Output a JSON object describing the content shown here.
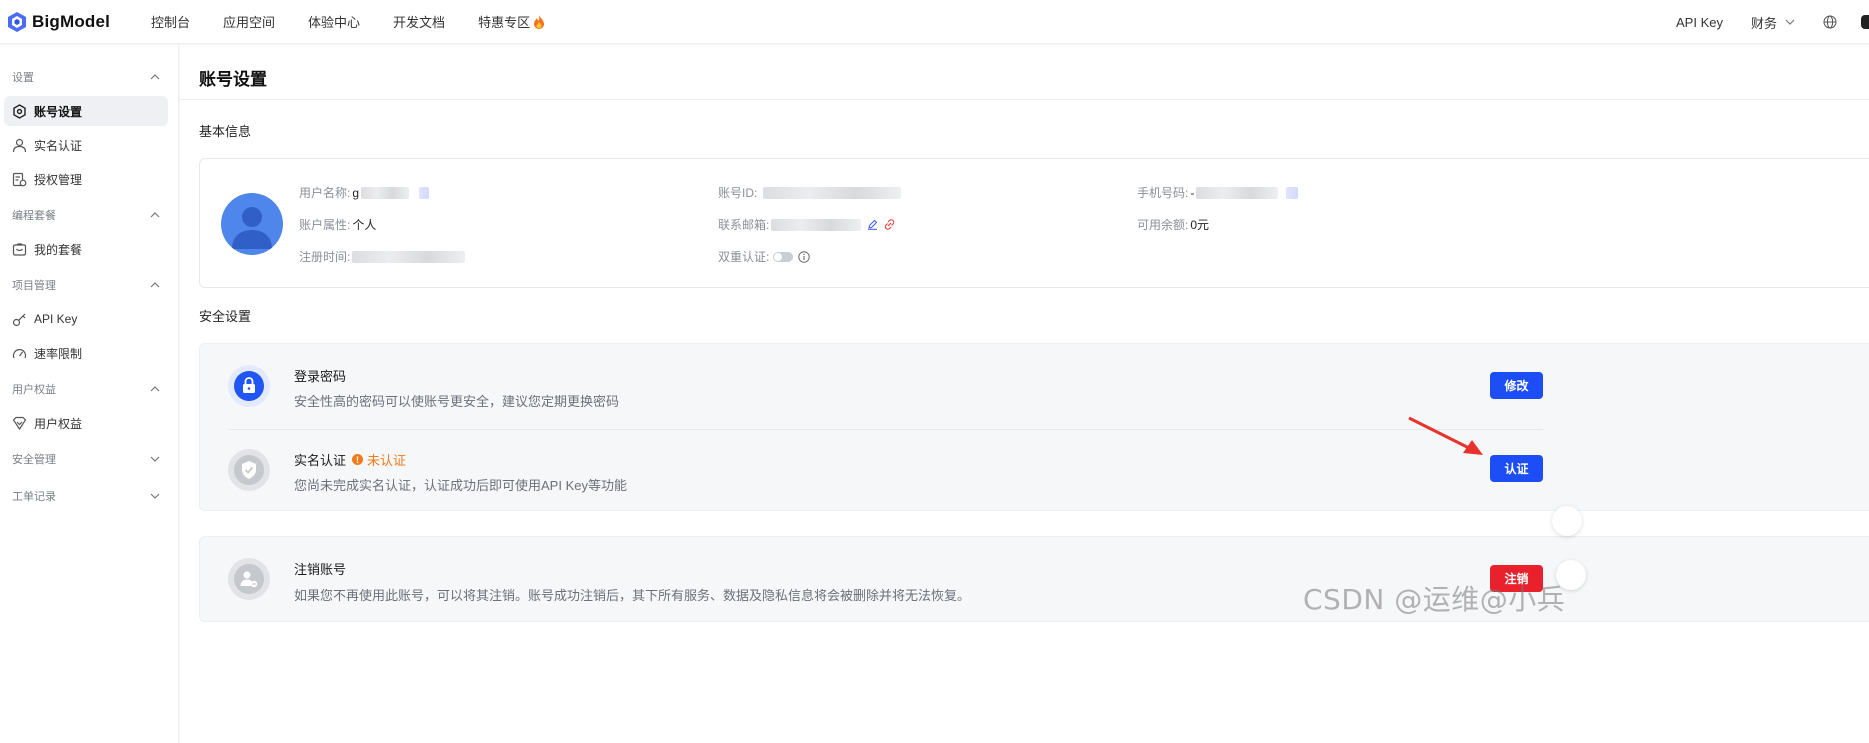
{
  "brand": {
    "name": "BigModel",
    "color": "#4a6cf7"
  },
  "topnav": {
    "items": [
      {
        "label": "控制台"
      },
      {
        "label": "应用空间"
      },
      {
        "label": "体验中心"
      },
      {
        "label": "开发文档"
      },
      {
        "label": "特惠专区",
        "icon": "fire-icon"
      }
    ],
    "right": {
      "api_key": "API Key",
      "finance": "财务",
      "icons": [
        "chevron-down-icon",
        "globe-icon"
      ]
    }
  },
  "sidebar": {
    "groups": [
      {
        "label": "设置",
        "expanded": true,
        "items": [
          {
            "label": "账号设置",
            "icon": "settings-icon",
            "active": true
          },
          {
            "label": "实名认证",
            "icon": "user-icon"
          },
          {
            "label": "授权管理",
            "icon": "authorize-icon"
          }
        ]
      },
      {
        "label": "编程套餐",
        "expanded": true,
        "items": [
          {
            "label": "我的套餐",
            "icon": "package-icon"
          }
        ]
      },
      {
        "label": "项目管理",
        "expanded": true,
        "items": [
          {
            "label": "API Key",
            "icon": "key-icon"
          },
          {
            "label": "速率限制",
            "icon": "gauge-icon"
          }
        ]
      },
      {
        "label": "用户权益",
        "expanded": true,
        "items": [
          {
            "label": "用户权益",
            "icon": "benefit-icon"
          }
        ]
      },
      {
        "label": "安全管理",
        "expanded": false,
        "items": []
      },
      {
        "label": "工单记录",
        "expanded": false,
        "items": []
      }
    ]
  },
  "main": {
    "title": "账号设置",
    "basic": {
      "title": "基本信息",
      "fields": {
        "username": {
          "label": "用户名称:",
          "value": "g"
        },
        "account_type": {
          "label": "账户属性:",
          "value": "个人"
        },
        "register_time": {
          "label": "注册时间:"
        },
        "account_id": {
          "label": "账号ID:"
        },
        "email": {
          "label": "联系邮箱:"
        },
        "two_factor": {
          "label": "双重认证:",
          "enabled": false
        },
        "phone": {
          "label": "手机号码:",
          "value": "-"
        },
        "balance": {
          "label": "可用余额:",
          "value": "0元"
        }
      }
    },
    "security": {
      "title": "安全设置",
      "rows": [
        {
          "name": "登录密码",
          "desc": "安全性高的密码可以使账号更安全，建议您定期更换密码",
          "button": "修改",
          "icon": "lock-icon"
        },
        {
          "name": "实名认证",
          "status": "未认证",
          "desc": "您尚未完成实名认证，认证成功后即可使用API Key等功能",
          "button": "认证",
          "icon": "shield-check-icon"
        },
        {
          "name": "注销账号",
          "desc": "如果您不再使用此账号，可以将其注销。账号成功注销后，其下所有服务、数据及隐私信息将会被删除并将无法恢复。",
          "button": "注销",
          "icon": "user-remove-icon"
        }
      ]
    }
  },
  "watermark": "CSDN @运维@小兵",
  "colors": {
    "primary": "#1d4ef5",
    "danger": "#e8212c",
    "warning": "#f27a1a",
    "annotation": "#e8322c"
  }
}
